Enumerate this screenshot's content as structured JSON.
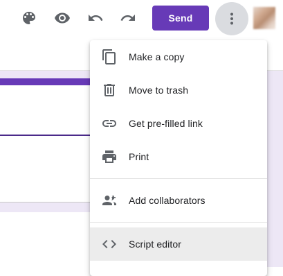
{
  "toolbar": {
    "icons": [
      "palette-icon",
      "eye-icon",
      "undo-icon",
      "redo-icon"
    ],
    "send_label": "Send",
    "more_icon": "more-vert-icon",
    "accent_color": "#673ab7"
  },
  "menu": {
    "items": [
      {
        "label": "Make a copy",
        "icon": "copy-icon"
      },
      {
        "label": "Move to trash",
        "icon": "trash-icon"
      },
      {
        "label": "Get pre-filled link",
        "icon": "link-icon"
      },
      {
        "label": "Print",
        "icon": "print-icon"
      },
      {
        "label": "Add collaborators",
        "icon": "add-people-icon"
      },
      {
        "label": "Script editor",
        "icon": "code-icon"
      }
    ],
    "highlighted": "Script editor"
  }
}
